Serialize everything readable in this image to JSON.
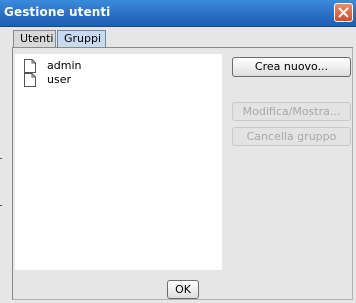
{
  "window": {
    "title": "Gestione utenti"
  },
  "tabs": [
    {
      "label": "Utenti",
      "selected": false
    },
    {
      "label": "Gruppi",
      "selected": true
    }
  ],
  "groups": {
    "items": [
      {
        "label": "admin",
        "icon": "document-icon"
      },
      {
        "label": "user",
        "icon": "document-icon"
      }
    ]
  },
  "actions": {
    "create_label": "Crea nuovo...",
    "modify_label": "Modifica/Mostra...",
    "delete_label": "Cancella gruppo",
    "ok_label": "OK"
  },
  "colors": {
    "titlebar": "#2a6fc6",
    "close_button": "#d54a22",
    "selected_tab": "#c7daf0",
    "disabled_text": "#a8a8a8"
  }
}
